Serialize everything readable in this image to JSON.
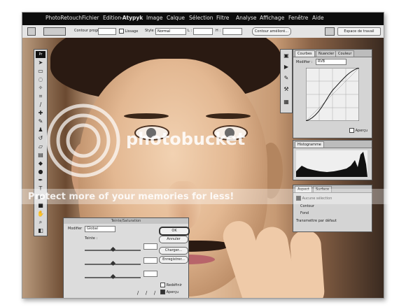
{
  "menubar": {
    "app": "PhotoRetouch",
    "items": [
      "Fichier",
      "Edition",
      "Image",
      "Calque",
      "Sélection",
      "Filtre",
      "Analyse",
      "Affichage",
      "Fenêtre",
      "Aide"
    ],
    "brand": "Atypyk"
  },
  "options": {
    "contour_label": "Contour progr.",
    "lissage_label": "Lissage",
    "style_label": "Style :",
    "style_value": "Normal",
    "l_label": "L :",
    "h_label": "H :",
    "refine_button": "Contour amélioré...",
    "workspace_label": "Espace de travail"
  },
  "toolbox": {
    "badge": "Pr"
  },
  "curves_panel": {
    "tabs": [
      "Courbes",
      "Nuancier",
      "Couleur"
    ],
    "modifier_label": "Modifier :",
    "channel_value": "RVB",
    "preview_label": "Aperçu"
  },
  "histogram_panel": {
    "tabs": [
      "Histogramme"
    ]
  },
  "layers_panel": {
    "tabs": [
      "Aspect",
      "Surface"
    ],
    "row1": "Aucune sélection",
    "row2": "Contour",
    "row3": "Fond",
    "row4": "Transmettre par défaut"
  },
  "dialog": {
    "title": "Teinte/Saturation",
    "field_label": "Modifier",
    "field_value": "Global",
    "label_teinte": "Teinte :",
    "ok": "OK",
    "cancel": "Annuler",
    "load": "Charger...",
    "save": "Enregistrer...",
    "colorize": "Redéfinir",
    "preview": "Aperçu"
  },
  "watermark": {
    "center": "photobucket",
    "band": "Protect more of your memories for less!"
  }
}
